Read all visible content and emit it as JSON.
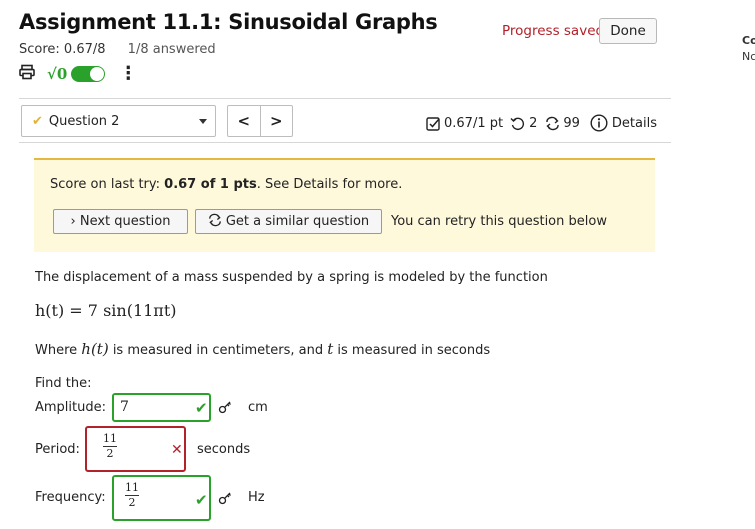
{
  "header": {
    "title": "Assignment 11.1: Sinusoidal Graphs",
    "score": "Score: 0.67/8",
    "answered": "1/8 answered",
    "progress": "Progress saved",
    "done_label": "Done"
  },
  "side": {
    "text1": "Co",
    "text2": "Nc"
  },
  "question_nav": {
    "selected": "Question 2",
    "prev_label": "<",
    "next_label": ">",
    "points": "0.67/1 pt",
    "retries": "2",
    "similar": "99",
    "details_label": "Details"
  },
  "alert": {
    "prefix": "Score on last try: ",
    "score_bold": "0.67 of 1 pts",
    "suffix": ". See Details for more.",
    "next_button": "› Next question",
    "similar_button": "Get a similar question",
    "retry_text": "You can retry this question below"
  },
  "question": {
    "intro": "The displacement of a mass suspended by a spring is modeled by the function",
    "formula": "h(t) = 7 sin(11πt)",
    "desc_where": "Where ",
    "desc_ht": "h(t)",
    "desc_mid": " is measured in centimeters, and ",
    "desc_t": "t",
    "desc_end": " is measured in seconds",
    "find": "Find the:",
    "amplitude": {
      "label": "Amplitude:",
      "value": "7",
      "unit": "cm",
      "status": "correct"
    },
    "period": {
      "label": "Period:",
      "num": "11",
      "den": "2",
      "unit": "seconds",
      "status": "incorrect"
    },
    "frequency": {
      "label": "Frequency:",
      "num": "11",
      "den": "2",
      "unit": "Hz",
      "status": "correct"
    }
  },
  "colors": {
    "correct": "#2aa12a",
    "incorrect": "#b2222a",
    "alert_bg": "#fff9dc",
    "alert_border": "#e5b841"
  },
  "icons": [
    "print-icon",
    "sqrt-toggle-icon",
    "kebab-menu-icon",
    "check-icon",
    "points-icon",
    "retry-icon",
    "similar-icon",
    "info-icon",
    "key-icon",
    "cross-icon"
  ]
}
